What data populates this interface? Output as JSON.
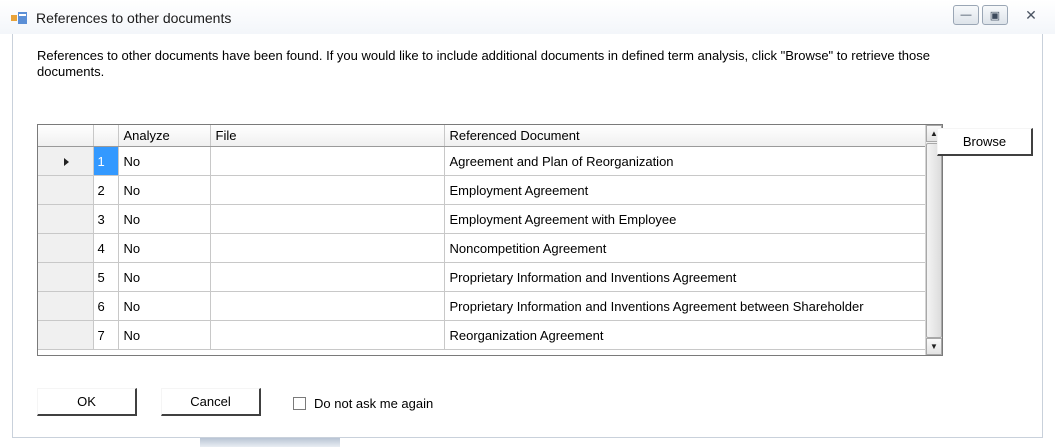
{
  "window": {
    "title": "References to other documents",
    "icon": "form-icon",
    "controls": {
      "minimize": "minimize-icon",
      "maximize": "maximize-icon",
      "close": "close-icon"
    }
  },
  "message": "References to other documents have been found. If you would like to include additional documents in defined term analysis, click \"Browse\" to retrieve those documents.",
  "grid": {
    "columns": [
      "",
      "",
      "Analyze",
      "File",
      "Referenced Document"
    ],
    "rows": [
      {
        "num": "1",
        "analyze": "No",
        "file": "",
        "document": "Agreement and Plan of Reorganization",
        "current": true
      },
      {
        "num": "2",
        "analyze": "No",
        "file": "",
        "document": "Employment Agreement",
        "current": false
      },
      {
        "num": "3",
        "analyze": "No",
        "file": "",
        "document": "Employment Agreement with Employee",
        "current": false
      },
      {
        "num": "4",
        "analyze": "No",
        "file": "",
        "document": "Noncompetition Agreement",
        "current": false
      },
      {
        "num": "5",
        "analyze": "No",
        "file": "",
        "document": "Proprietary Information and Inventions Agreement",
        "current": false
      },
      {
        "num": "6",
        "analyze": "No",
        "file": "",
        "document": "Proprietary Information and Inventions Agreement between Shareholder",
        "current": false
      },
      {
        "num": "7",
        "analyze": "No",
        "file": "",
        "document": "Reorganization Agreement",
        "current": false
      }
    ]
  },
  "buttons": {
    "browse": "Browse",
    "ok": "OK",
    "cancel": "Cancel"
  },
  "checkbox": {
    "label": "Do not ask me again",
    "checked": false
  },
  "colors": {
    "selection": "#3399ff",
    "title_bar": "#f3f6fa"
  }
}
